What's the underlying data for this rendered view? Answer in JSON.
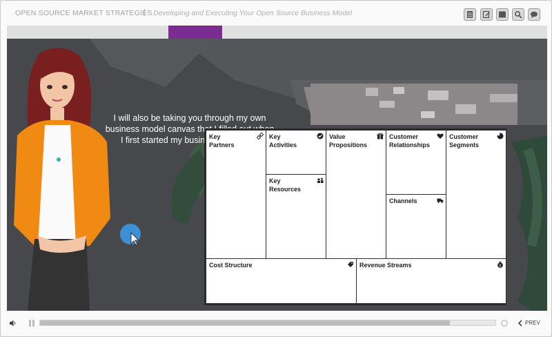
{
  "header": {
    "course_title": "OPEN SOURCE MARKET STRATEGIES",
    "separator": "|",
    "lesson_title": "Developing and Executing Your Open Source Business Model",
    "tools": [
      "menu-icon",
      "notes-icon",
      "glossary-icon",
      "search-icon",
      "chat-icon"
    ]
  },
  "slide": {
    "caption": "I will also be taking you through my own business model canvas that I filled out when I first started my business, Publition.",
    "canvas": {
      "key_partners": "Key\nPartners",
      "key_activities": "Key\nActivities",
      "value_propositions": "Value\nPropositions",
      "customer_relationships": "Customer\nRelationships",
      "customer_segments": "Customer\nSegments",
      "key_resources": "Key\nResources",
      "channels": "Channels",
      "cost_structure": "Cost Structure",
      "revenue_streams": "Revenue Streams"
    }
  },
  "player": {
    "progress": 0.9,
    "prev_label": "PREV"
  },
  "colors": {
    "accent": "#7b2c91",
    "cursor_highlight": "#3d8fd6",
    "jacket": "#f08a12",
    "hair": "#7a1f1f"
  }
}
